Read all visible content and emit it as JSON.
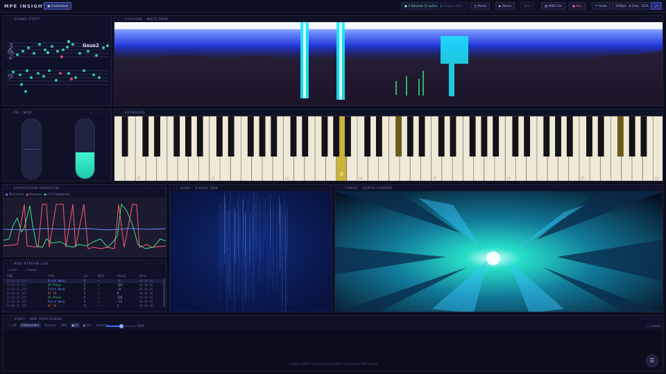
{
  "app": {
    "title": "MPE INSIGHT",
    "connection": "Connected"
  },
  "topbar": {
    "devices": "4 Devices (1 active)",
    "replay": "Replay (00)…",
    "panel": "Panel",
    "demo": "Demo",
    "rect": "Rect",
    "midi_file": "MIDI File",
    "rec": "Rec",
    "undo": "Undo",
    "stats": "104fps · 8.1ms · 55%"
  },
  "panels": {
    "grand_staff": "GRAND STAFF",
    "cascade": "CASCADE · NOTE RAIN",
    "pb_mod": "PB / MOD",
    "keyboard": "KEYBOARD",
    "expression": "EXPRESSION OVERVIEW",
    "aura": "AURA · VISUAL ORB",
    "forge": "FORGE · DEPTH SHADER",
    "midi_log": "MIDI STREAM LOG",
    "orbit": "ORBIT · MPE PROCESSOR"
  },
  "grand_staff": {
    "chord": "Gsus2"
  },
  "keyboard": {
    "octave_labels": [
      "C1",
      "C2",
      "C3",
      "C4",
      "C5",
      "C6",
      "C7",
      "C8"
    ]
  },
  "expression": {
    "legend": [
      "Pitch bend",
      "Pressure",
      "CC74 brightness"
    ]
  },
  "midi_log": {
    "toolbar": [
      "Clear",
      "Export"
    ],
    "columns": [
      "TIME",
      "TYPE",
      "CH",
      "NOTE",
      "VALUE",
      "DATA"
    ],
    "rows": [
      [
        "12:09:35.355",
        "Pitch Bend",
        "5",
        "—",
        "-1",
        "00 00 00"
      ],
      [
        "12:09:35.352",
        "Ch Press",
        "5",
        "—",
        "119",
        "00 00 00"
      ],
      [
        "12:09:35.350",
        "Pitch Bend",
        "5",
        "—",
        "-8",
        "00 00 00"
      ],
      [
        "12:09:35.348",
        "CC 74",
        "5",
        "—",
        "8",
        "00 00 00"
      ],
      [
        "12:09:35.345",
        "Ch Press",
        "5",
        "—",
        "126",
        "00 00 00"
      ],
      [
        "12:09:35.342",
        "Pitch Bend",
        "5",
        "—",
        "-21",
        "00 00 00"
      ],
      [
        "12:09:35.339",
        "CC 74",
        "5",
        "—",
        "1",
        "00 00 00"
      ]
    ]
  },
  "orbit": {
    "toolbar": [
      "Off",
      "Independent",
      "Pressure",
      "MPE",
      "In",
      "Out",
      "Intensity",
      "100%"
    ],
    "status": "1 output",
    "message": "Enable ORBIT to turn incoming MIDI into a second MPE stream"
  },
  "colors": {
    "accent": "#4c5bc9",
    "pressed_key": "#c8b23a",
    "cascade_blue": "#2d49e6",
    "cascade_cyan": "#1ee8ff"
  }
}
